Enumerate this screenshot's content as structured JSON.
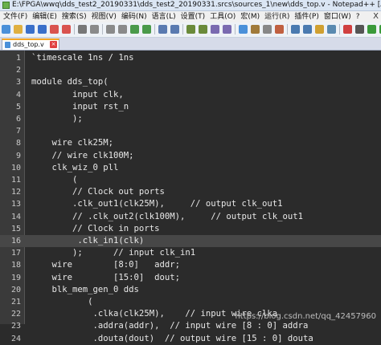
{
  "window": {
    "title": "E:\\FPGA\\wwq\\dds_test2_20190331\\dds_test2_20190331.srcs\\sources_1\\new\\dds_top.v - Notepad++ [Administrat"
  },
  "menu": {
    "items": [
      "文件(F)",
      "编辑(E)",
      "搜索(S)",
      "视图(V)",
      "编码(N)",
      "语言(L)",
      "设置(T)",
      "工具(O)",
      "宏(M)",
      "运行(R)",
      "插件(P)",
      "窗口(W)",
      "?"
    ],
    "close": "X"
  },
  "toolbar": {
    "buttons": [
      "new-icon",
      "open-icon",
      "save-icon",
      "save-all-icon",
      "close-icon",
      "close-all-icon",
      "print-icon",
      "cut-icon",
      "copy-icon",
      "paste-icon",
      "undo-icon",
      "redo-icon",
      "find-icon",
      "replace-icon",
      "zoom-in-icon",
      "zoom-out-icon",
      "sync-v-icon",
      "sync-h-icon",
      "word-wrap-icon",
      "show-all-icon",
      "indent-guide-icon",
      "udl-icon",
      "doc-map-icon",
      "func-list-icon",
      "folder-workspace-icon",
      "monitor-icon",
      "record-icon",
      "stop-icon",
      "play-icon",
      "play-multi-icon",
      "save-macro-icon",
      "spellcheck-icon"
    ]
  },
  "tab": {
    "label": "dds_top.v"
  },
  "editor": {
    "current_line": 16,
    "lines": [
      {
        "num": "1",
        "text": "`timescale 1ns / 1ns"
      },
      {
        "num": "2",
        "text": ""
      },
      {
        "num": "3",
        "text": "module dds_top("
      },
      {
        "num": "4",
        "text": "        input clk,"
      },
      {
        "num": "5",
        "text": "        input rst_n"
      },
      {
        "num": "6",
        "text": "        );"
      },
      {
        "num": "7",
        "text": ""
      },
      {
        "num": "8",
        "text": "    wire clk25M;"
      },
      {
        "num": "9",
        "text": "    // wire clk100M;"
      },
      {
        "num": "10",
        "text": "    clk_wiz_0 pll"
      },
      {
        "num": "11",
        "text": "        ("
      },
      {
        "num": "12",
        "text": "        // Clock out ports"
      },
      {
        "num": "13",
        "text": "        .clk_out1(clk25M),     // output clk_out1"
      },
      {
        "num": "14",
        "text": "        // .clk_out2(clk100M),     // output clk_out1"
      },
      {
        "num": "15",
        "text": "        // Clock in ports"
      },
      {
        "num": "16",
        "text": "         .clk_in1(clk)"
      },
      {
        "num": "17",
        "text": "        );      // input clk_in1"
      },
      {
        "num": "18",
        "text": "    wire        [8:0]   addr;"
      },
      {
        "num": "19",
        "text": "    wire        [15:0]  dout;"
      },
      {
        "num": "20",
        "text": "    blk_mem_gen_0 dds"
      },
      {
        "num": "21",
        "text": "           ("
      },
      {
        "num": "22",
        "text": "            .clka(clk25M),    // input wire clka"
      },
      {
        "num": "23",
        "text": "            .addra(addr),  // input wire [8 : 0] addra"
      },
      {
        "num": "24",
        "text": "            .douta(dout)  // output wire [15 : 0] douta"
      }
    ]
  },
  "watermark": "https://blog.csdn.net/qq_42457960",
  "colors": {
    "editor_bg": "#2b2b2b",
    "gutter_bg": "#3a3a3a",
    "current_line_bg": "#474747",
    "text": "#e8e8e8",
    "tab_accent": "#f5a623"
  }
}
